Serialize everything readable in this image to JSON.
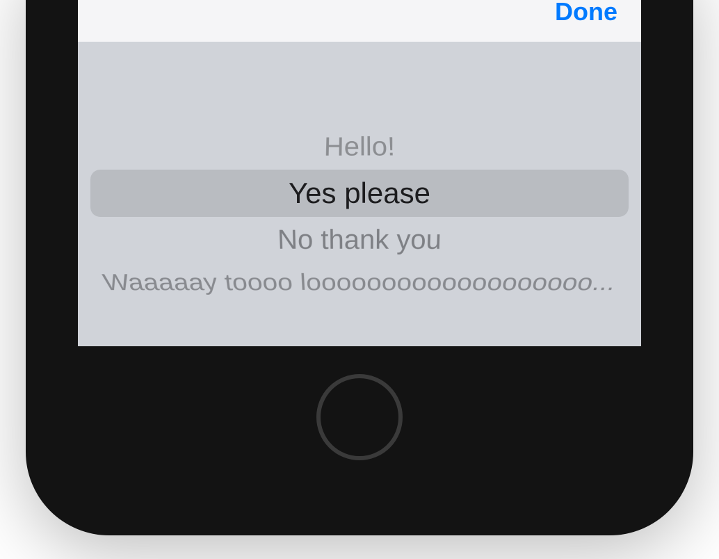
{
  "toolbar": {
    "done_label": "Done"
  },
  "picker": {
    "options": [
      "Hello!",
      "Yes please",
      "No thank you",
      "Waaaaay toooo looooooooooooooooooo..."
    ],
    "selected_index": 1
  }
}
